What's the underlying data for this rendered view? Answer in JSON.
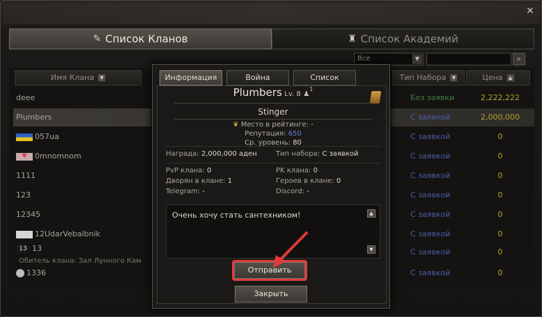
{
  "tabs": [
    {
      "label": "Список Кланов",
      "icon": "scroll-icon",
      "active": true
    },
    {
      "label": "Список Академий",
      "icon": "academy-icon",
      "active": false
    }
  ],
  "filter": {
    "selected": "Все"
  },
  "columns": {
    "name": "Имя Клана",
    "type": "Тип Набора",
    "price": "Цена"
  },
  "rows": [
    {
      "name": "deee",
      "type": "Без заявки",
      "price": "2,222,222",
      "green": true
    },
    {
      "name": "Plumbers",
      "type": "С заявкой",
      "price": "2,000,000",
      "selected": true
    },
    {
      "name": "057ua",
      "type": "С заявкой",
      "price": "0",
      "crest": "ua"
    },
    {
      "name": "0mnomnom",
      "type": "С заявкой",
      "price": "0",
      "crest": "heart"
    },
    {
      "name": "1111",
      "type": "С заявкой",
      "price": "0"
    },
    {
      "name": "123",
      "type": "С заявкой",
      "price": "0"
    },
    {
      "name": "12345",
      "type": "С заявкой",
      "price": "0"
    },
    {
      "name": "12UdarVebalbnik",
      "type": "С заявкой",
      "price": "0",
      "crest": "dark"
    },
    {
      "name": "13",
      "sub": "Обитель клана: Зал Лунного Кам",
      "type": "С заявкой",
      "price": "0",
      "crest": "13"
    },
    {
      "name": "1336",
      "type": "С заявкой",
      "price": "0",
      "crest": "circle"
    }
  ],
  "modal": {
    "tabs": [
      "Информация",
      "Война",
      "Список"
    ],
    "clan_name": "Plumbers",
    "level": "Lv. 8",
    "member_count": "1",
    "leader": "Stinger",
    "rank_label": "Место в рейтинге:",
    "rank_value": "-",
    "reputation_label": "Репутация:",
    "reputation_value": "650",
    "avg_level_label": "Ср. уровень:",
    "avg_level_value": "80",
    "reward_label": "Награда:",
    "reward_value": "2,000,000 аден",
    "recruit_label": "Тип набора:",
    "recruit_value": "С заявкой",
    "pvp_label": "PvP клана:",
    "pvp_value": "0",
    "pk_label": "PK клана:",
    "pk_value": "0",
    "nobles_label": "Дворян в клане:",
    "nobles_value": "1",
    "heroes_label": "Героев в клане:",
    "heroes_value": "0",
    "telegram_label": "Telegram:",
    "telegram_value": "-",
    "discord_label": "Discord:",
    "discord_value": "-",
    "message": "Очень хочу стать сантехником!",
    "send_label": "Отправить",
    "close_label": "Закрыть"
  },
  "colors": {
    "accent_red": "#e23b3b",
    "link_blue": "#4e5ba8",
    "price_gold": "#b3a52f",
    "no_request_green": "#3f7e3f"
  }
}
